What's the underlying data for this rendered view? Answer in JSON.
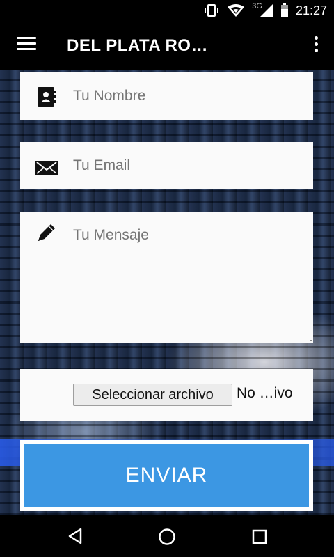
{
  "status_bar": {
    "network_type": "3G",
    "time": "21:27",
    "icons": [
      "vibrate-icon",
      "wifi-icon",
      "signal-icon",
      "battery-icon"
    ]
  },
  "app_bar": {
    "title": "DEL PLATA RO…",
    "menu_icon": "menu-icon",
    "more_icon": "more-vert-icon"
  },
  "form": {
    "name_placeholder": "Tu Nombre",
    "email_placeholder": "Tu Email",
    "message_placeholder": "Tu Mensaje",
    "file_button_label": "Seleccionar archivo",
    "file_status": "No …ivo",
    "submit_label": "ENVIAR"
  },
  "colors": {
    "submit_bg": "#3c97e3",
    "field_bg": "#fafafa"
  },
  "nav_bar": {
    "icons": [
      "back-icon",
      "home-icon",
      "recents-icon"
    ]
  }
}
